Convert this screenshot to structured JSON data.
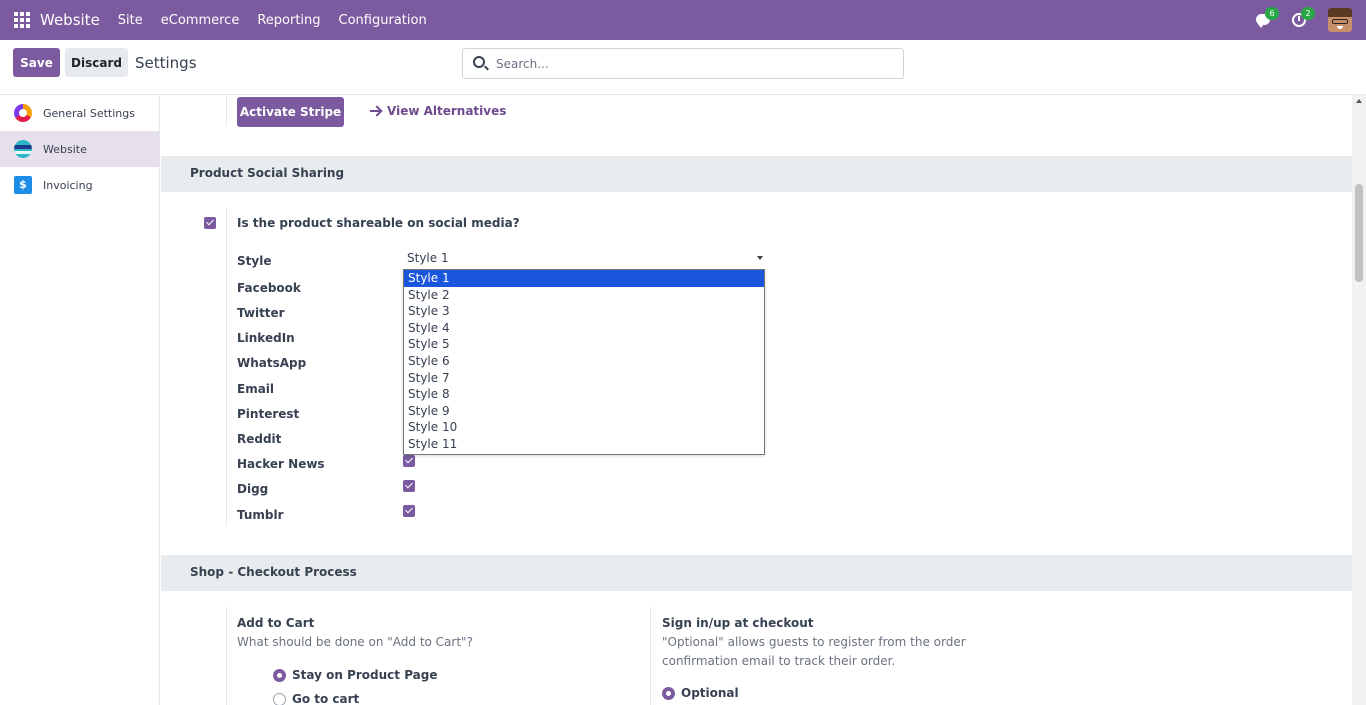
{
  "navbar": {
    "brand": "Website",
    "menu": [
      "Site",
      "eCommerce",
      "Reporting",
      "Configuration"
    ],
    "messages_count": "6",
    "activities_count": "2",
    "color": "#7c5aa0"
  },
  "control": {
    "save_label": "Save",
    "discard_label": "Discard",
    "title": "Settings",
    "search_placeholder": "Search..."
  },
  "sidebar": {
    "items": [
      {
        "label": "General Settings",
        "icon": "general-settings-icon"
      },
      {
        "label": "Website",
        "icon": "website-icon",
        "active": true
      },
      {
        "label": "Invoicing",
        "icon": "invoicing-icon",
        "glyph": "$"
      }
    ]
  },
  "payment": {
    "activate_label": "Activate Stripe",
    "alternatives_label": "View Alternatives"
  },
  "social": {
    "section_title": "Product Social Sharing",
    "question": "Is the product shareable on social media?",
    "style_label": "Style",
    "style_value": "Style 1",
    "style_options": [
      "Style 1",
      "Style 2",
      "Style 3",
      "Style 4",
      "Style 5",
      "Style 6",
      "Style 7",
      "Style 8",
      "Style 9",
      "Style 10",
      "Style 11"
    ],
    "networks": [
      "Facebook",
      "Twitter",
      "LinkedIn",
      "WhatsApp",
      "Email",
      "Pinterest",
      "Reddit",
      "Hacker News",
      "Digg",
      "Tumblr"
    ]
  },
  "checkout": {
    "section_title": "Shop - Checkout Process",
    "add_to_cart": {
      "title": "Add to Cart",
      "description": "What should be done on \"Add to Cart\"?",
      "options": [
        "Stay on Product Page",
        "Go to cart"
      ]
    },
    "signin": {
      "title": "Sign in/up at checkout",
      "description_line1": "\"Optional\" allows guests to register from the order",
      "description_line2": "confirmation email to track their order.",
      "option": "Optional"
    }
  }
}
